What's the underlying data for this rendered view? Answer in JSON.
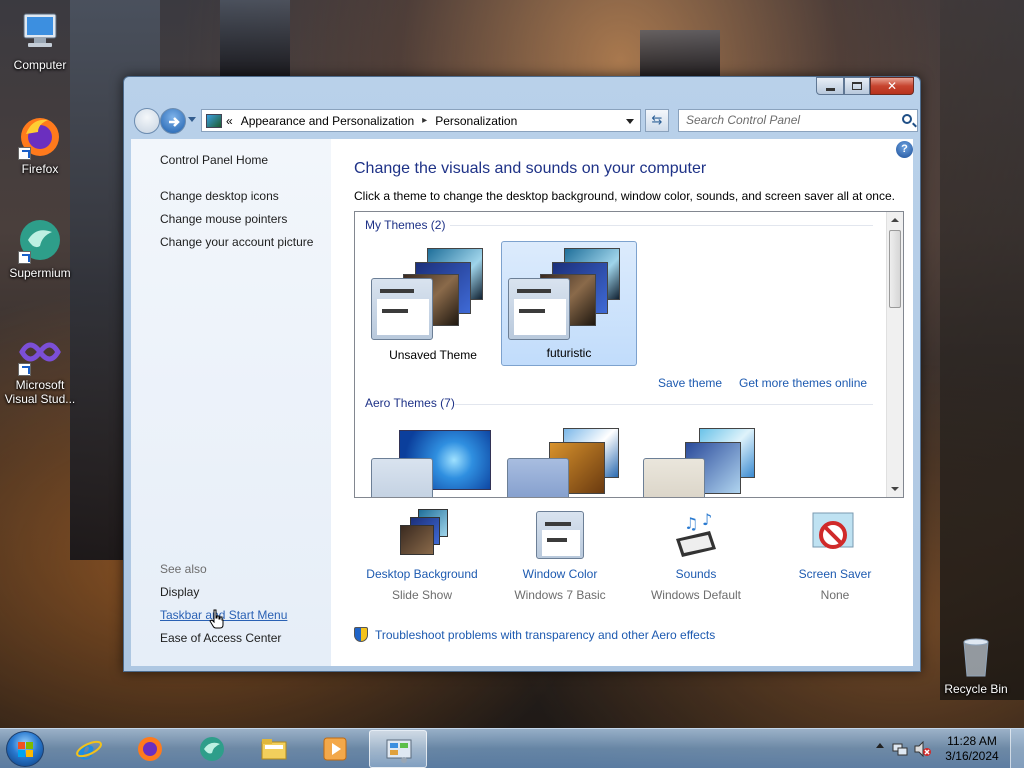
{
  "desktop": {
    "icons": [
      {
        "label": "Computer"
      },
      {
        "label": "Firefox"
      },
      {
        "label": "Supermium"
      },
      {
        "label": "Microsoft Visual Stud..."
      },
      {
        "label": "Recycle Bin"
      }
    ]
  },
  "window": {
    "address": {
      "overflow": "«",
      "crumbs": [
        "Appearance and Personalization",
        "Personalization"
      ],
      "separator": "▸"
    },
    "search": {
      "placeholder": "Search Control Panel"
    },
    "sidebar": {
      "top_links": [
        "Control Panel Home",
        "Change desktop icons",
        "Change mouse pointers",
        "Change your account picture"
      ],
      "see_also_heading": "See also",
      "see_also_links": [
        "Display",
        "Taskbar and Start Menu",
        "Ease of Access Center"
      ]
    },
    "main": {
      "title": "Change the visuals and sounds on your computer",
      "subtitle": "Click a theme to change the desktop background, window color, sounds, and screen saver all at once.",
      "my_themes_heading": "My Themes (2)",
      "my_themes": [
        {
          "name": "Unsaved Theme",
          "selected": false
        },
        {
          "name": "futuristic",
          "selected": true
        }
      ],
      "save_theme": "Save theme",
      "get_more": "Get more themes online",
      "aero_heading": "Aero Themes (7)",
      "bottom_items": [
        {
          "title": "Desktop Background",
          "value": "Slide Show"
        },
        {
          "title": "Window Color",
          "value": "Windows 7 Basic"
        },
        {
          "title": "Sounds",
          "value": "Windows Default"
        },
        {
          "title": "Screen Saver",
          "value": "None"
        }
      ],
      "troubleshoot": "Troubleshoot problems with transparency and other Aero effects"
    }
  },
  "taskbar": {
    "pinned": [
      "start-button",
      "internet-explorer",
      "firefox",
      "supermium",
      "file-explorer",
      "media-player",
      "control-panel"
    ],
    "active": "control-panel",
    "clock": {
      "time": "11:28 AM",
      "date": "3/16/2024"
    }
  }
}
